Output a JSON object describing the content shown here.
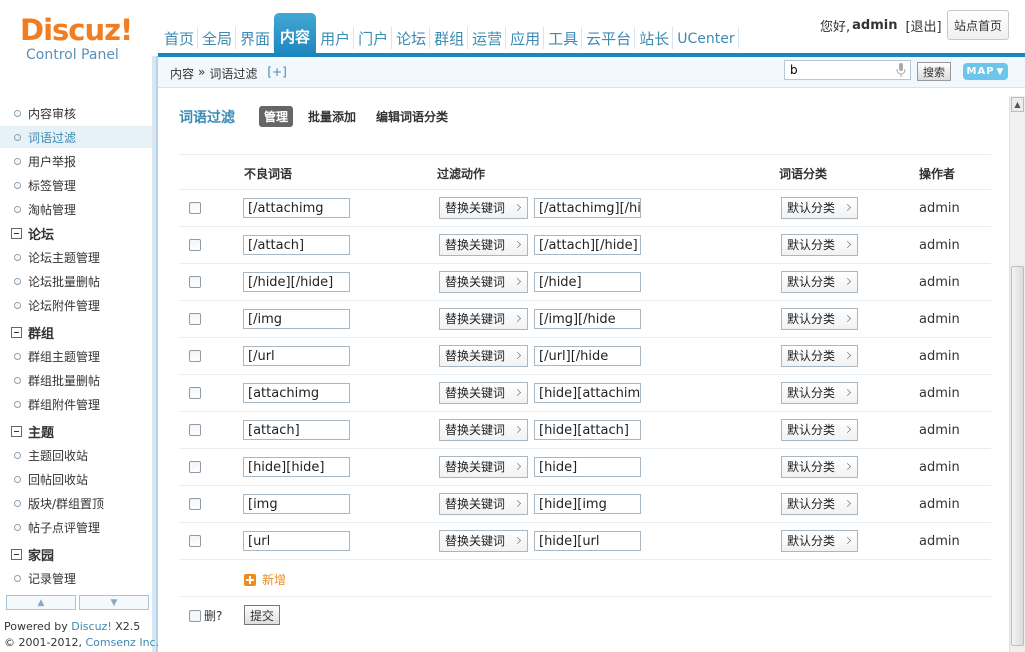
{
  "header": {
    "logo_text": "Discuz!",
    "logo_sub": "Control Panel",
    "nav": [
      "首页",
      "全局",
      "界面",
      "内容",
      "用户",
      "门户",
      "论坛",
      "群组",
      "运营",
      "应用",
      "工具",
      "云平台",
      "站长",
      "UCenter"
    ],
    "active_nav": "内容",
    "greeting": "您好,",
    "username": "admin",
    "logout": "[退出]",
    "site_home": "站点首页"
  },
  "subheader": {
    "breadcrumb_section": "内容",
    "breadcrumb_sep": "»",
    "breadcrumb_page": "词语过滤",
    "add_shortcut": "[+]",
    "search_value": "b",
    "search_button": "搜索",
    "map_button": "MAP"
  },
  "sidebar": {
    "items": [
      {
        "type": "item",
        "label": "内容审核"
      },
      {
        "type": "item",
        "label": "词语过滤",
        "active": true
      },
      {
        "type": "item",
        "label": "用户举报"
      },
      {
        "type": "item",
        "label": "标签管理"
      },
      {
        "type": "item",
        "label": "淘帖管理"
      },
      {
        "type": "group",
        "label": "论坛"
      },
      {
        "type": "item",
        "label": "论坛主题管理"
      },
      {
        "type": "item",
        "label": "论坛批量删帖"
      },
      {
        "type": "item",
        "label": "论坛附件管理"
      },
      {
        "type": "group",
        "label": "群组"
      },
      {
        "type": "item",
        "label": "群组主题管理"
      },
      {
        "type": "item",
        "label": "群组批量删帖"
      },
      {
        "type": "item",
        "label": "群组附件管理"
      },
      {
        "type": "group",
        "label": "主题"
      },
      {
        "type": "item",
        "label": "主题回收站"
      },
      {
        "type": "item",
        "label": "回帖回收站"
      },
      {
        "type": "item",
        "label": "版块/群组置顶"
      },
      {
        "type": "item",
        "label": "帖子点评管理"
      },
      {
        "type": "group",
        "label": "家园"
      },
      {
        "type": "item",
        "label": "记录管理"
      }
    ],
    "powered_prefix": "Powered by ",
    "powered_product": "Discuz!",
    "powered_version": " X2.5",
    "copyright_prefix": "© 2001-2012, ",
    "copyright_company": "Comsenz Inc."
  },
  "main": {
    "title": "词语过滤",
    "tabs": [
      "管理",
      "批量添加",
      "编辑词语分类"
    ],
    "active_tab": "管理",
    "columns": [
      "不良词语",
      "过滤动作",
      "词语分类",
      "操作者"
    ],
    "rows": [
      {
        "word": "[/attachimg",
        "action": "替换关键词",
        "replacement": "[/attachimg][/hi",
        "category": "默认分类",
        "operator": "admin"
      },
      {
        "word": "[/attach]",
        "action": "替换关键词",
        "replacement": "[/attach][/hide]",
        "category": "默认分类",
        "operator": "admin"
      },
      {
        "word": "[/hide][/hide]",
        "action": "替换关键词",
        "replacement": "[/hide]",
        "category": "默认分类",
        "operator": "admin"
      },
      {
        "word": "[/img",
        "action": "替换关键词",
        "replacement": "[/img][/hide",
        "category": "默认分类",
        "operator": "admin"
      },
      {
        "word": "[/url",
        "action": "替换关键词",
        "replacement": "[/url][/hide",
        "category": "默认分类",
        "operator": "admin"
      },
      {
        "word": "[attachimg",
        "action": "替换关键词",
        "replacement": "[hide][attachimg",
        "category": "默认分类",
        "operator": "admin"
      },
      {
        "word": "[attach]",
        "action": "替换关键词",
        "replacement": "[hide][attach]",
        "category": "默认分类",
        "operator": "admin"
      },
      {
        "word": "[hide][hide]",
        "action": "替换关键词",
        "replacement": "[hide]",
        "category": "默认分类",
        "operator": "admin"
      },
      {
        "word": "[img",
        "action": "替换关键词",
        "replacement": "[hide][img",
        "category": "默认分类",
        "operator": "admin"
      },
      {
        "word": "[url",
        "action": "替换关键词",
        "replacement": "[hide][url",
        "category": "默认分类",
        "operator": "admin"
      }
    ],
    "add_new": "新增",
    "delete_label": "删?",
    "submit": "提交"
  },
  "colors": {
    "accent": "#1b86bd",
    "link": "#3c8bb4",
    "logo": "#f27d21",
    "add": "#f08c1c"
  }
}
